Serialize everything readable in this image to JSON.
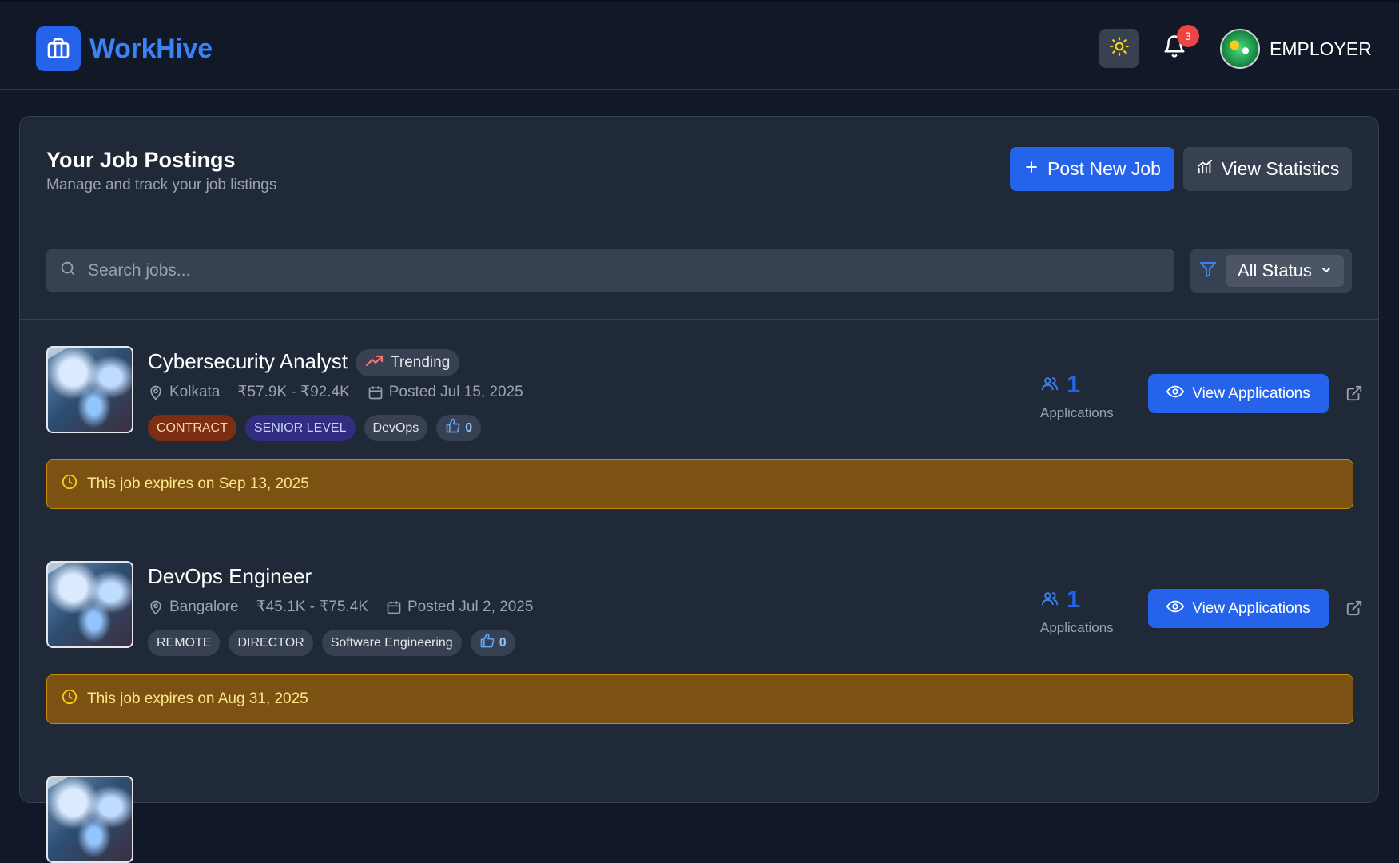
{
  "app": {
    "name": "WorkHive",
    "brand_color": "#2563eb"
  },
  "header": {
    "notification_count": "3",
    "user_role": "EMPLOYER"
  },
  "page": {
    "title": "Your Job Postings",
    "subtitle": "Manage and track your job listings",
    "post_button": "Post New Job",
    "stats_button": "View Statistics"
  },
  "filters": {
    "search_placeholder": "Search jobs...",
    "status_selected": "All Status"
  },
  "jobs": [
    {
      "title": "Cybersecurity Analyst",
      "badge": "Trending",
      "location": "Kolkata",
      "salary": "₹57.9K - ₹92.4K",
      "posted": "Posted Jul 15, 2025",
      "tags": [
        "CONTRACT",
        "SENIOR LEVEL",
        "DevOps"
      ],
      "likes": "0",
      "applications_count": "1",
      "applications_label": "Applications",
      "view_button": "View Applications",
      "expiry": "This job expires on Sep 13, 2025"
    },
    {
      "title": "DevOps Engineer",
      "location": "Bangalore",
      "salary": "₹45.1K - ₹75.4K",
      "posted": "Posted Jul 2, 2025",
      "tags": [
        "REMOTE",
        "DIRECTOR",
        "Software Engineering"
      ],
      "likes": "0",
      "applications_count": "1",
      "applications_label": "Applications",
      "view_button": "View Applications",
      "expiry": "This job expires on Aug 31, 2025"
    }
  ],
  "icons": {
    "logo": "briefcase-icon",
    "theme": "sun-icon",
    "notifications": "bell-icon",
    "search": "search-icon",
    "filter": "filter-icon",
    "trending": "trending-up-icon",
    "location": "map-pin-icon",
    "date": "calendar-icon",
    "likes": "thumbs-up-icon",
    "applicants": "users-icon",
    "view": "eye-icon",
    "open": "external-link-icon",
    "expiry": "clock-icon"
  }
}
